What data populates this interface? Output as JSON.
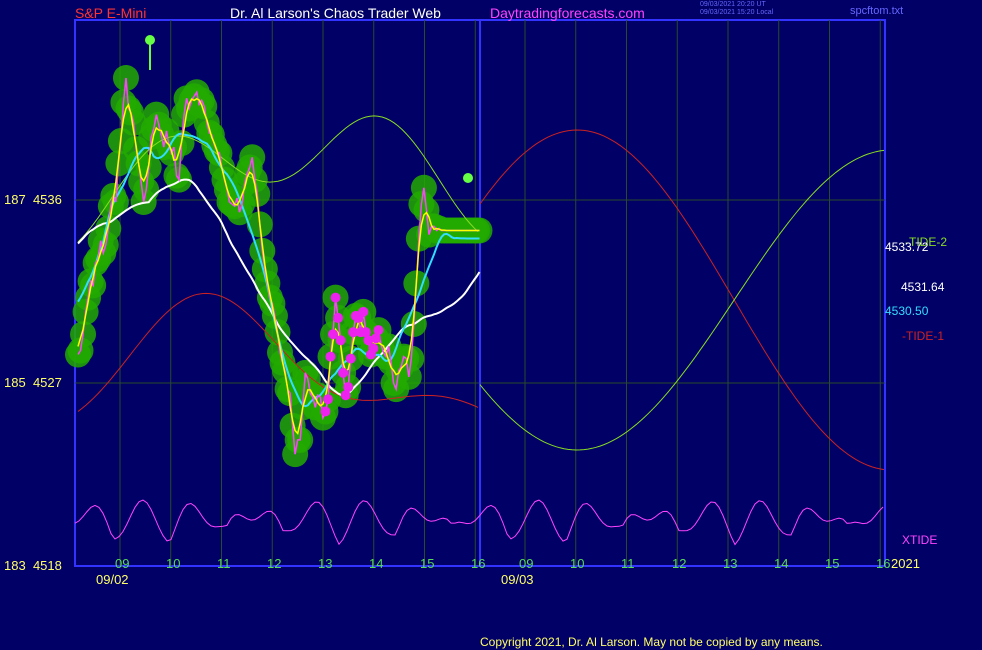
{
  "header": {
    "instrument": "S&P E-Mini",
    "site_title": "Dr. Al Larson's Chaos Trader Web",
    "url": "Daytradingforecasts.com",
    "timestamp_utc": "09/03/2021 20:20 UT",
    "timestamp_local": "09/03/2021 15:20 Local",
    "file": "spcftom.txt"
  },
  "footer": {
    "copyright": "Copyright 2021, Dr. Al Larson. May not be copied by any means."
  },
  "colors": {
    "background": "#000066",
    "frame": "#3333ff",
    "grid": "#2a4a2a",
    "price": "#ff44ff",
    "fast_ma": "#ffff00",
    "mid_ma": "#33ddff",
    "slow_ma": "#ffffff",
    "tide1": "#cc2222",
    "tide2": "#88dd22",
    "xtide": "#ff44ff",
    "green_band": "#22aa00",
    "magenta_dot": "#ee22ee"
  },
  "chart_data": {
    "type": "line",
    "title": "S&P E-Mini",
    "y_left_ticks": [
      {
        "label": "187",
        "price": "4536"
      },
      {
        "label": "185",
        "price": "4527"
      },
      {
        "label": "183",
        "price": "4518"
      }
    ],
    "ylim": [
      4518,
      4536
    ],
    "x_hour_ticks_day1": [
      "09",
      "10",
      "11",
      "12",
      "13",
      "14",
      "15",
      "16"
    ],
    "x_hour_ticks_day2": [
      "09",
      "10",
      "11",
      "12",
      "13",
      "14",
      "15",
      "16"
    ],
    "x_dates": [
      "09/02",
      "09/03"
    ],
    "year_label": "2021",
    "right_labels": [
      {
        "text": "-TIDE-2",
        "color": "#88dd22"
      },
      {
        "text": "4533.72",
        "color": "#ffffff"
      },
      {
        "text": "4531.64",
        "color": "#ffffff"
      },
      {
        "text": "4530.50",
        "color": "#33ddff"
      },
      {
        "text": "-TIDE-1",
        "color": "#cc2222"
      },
      {
        "text": "XTIDE",
        "color": "#ff44ff"
      }
    ],
    "series": [
      {
        "name": "price",
        "color": "#ff44ff",
        "x": [
          0,
          0.05,
          0.1,
          0.15,
          0.2,
          0.25,
          0.3,
          0.35,
          0.4,
          0.45,
          0.5,
          0.55,
          0.6,
          0.65,
          0.7,
          0.75,
          0.8,
          0.85,
          0.9,
          0.95,
          1.0,
          1.05,
          1.1,
          1.15,
          1.2,
          1.25,
          1.3,
          1.35,
          1.4,
          1.45,
          1.5,
          1.55,
          1.6,
          1.65,
          1.7,
          1.75,
          1.8,
          1.85,
          1.9,
          1.95,
          2.0,
          2.05,
          2.1,
          2.15,
          2.2,
          2.25,
          2.3,
          2.35,
          2.4,
          2.45,
          2.5,
          2.55,
          2.6,
          2.65,
          2.7,
          2.75,
          2.8,
          2.85,
          2.9,
          2.95,
          3.0,
          3.05,
          3.1,
          3.15,
          3.2,
          3.25,
          3.3,
          3.35,
          3.4,
          3.45,
          3.5,
          3.55,
          3.6,
          3.65,
          3.7,
          3.75,
          3.8,
          3.85,
          3.9,
          3.95,
          4.0,
          4.05,
          4.1,
          4.15,
          4.2,
          4.25,
          4.3,
          4.35,
          4.4,
          4.45,
          4.5,
          4.55,
          4.6,
          4.65,
          4.7,
          4.75,
          4.8,
          4.85,
          4.9,
          4.95,
          5.0,
          5.05,
          5.1,
          5.15,
          5.2,
          5.25,
          5.3,
          5.35,
          5.4,
          5.45,
          5.5,
          5.55,
          5.6,
          5.65,
          5.7,
          5.75,
          5.8,
          5.85,
          5.9,
          5.95,
          6.0,
          6.05,
          6.1,
          6.15,
          6.2,
          6.25,
          6.3,
          6.35,
          6.4,
          6.45,
          6.5,
          6.55,
          6.6,
          6.65,
          6.7,
          6.75,
          6.8,
          6.85,
          6.9,
          6.95,
          7.0,
          7.05,
          7.1,
          7.15,
          7.2,
          7.25,
          7.3,
          7.35,
          7.4,
          7.45,
          7.5,
          7.55,
          7.6,
          7.65,
          7.7,
          7.75,
          7.8,
          7.85,
          7.9,
          7.95,
          8.0
        ],
        "values": [
          4528.4,
          4528.6,
          4529.4,
          4530.5,
          4531.2,
          4532.0,
          4531.8,
          4532.9,
          4533.1,
          4534.0,
          4533.4,
          4533.8,
          4534.6,
          4535.7,
          4536.2,
          4535.9,
          4537.8,
          4538.9,
          4540.8,
          4542.0,
          4540.5,
          4540.3,
          4539.8,
          4538.5,
          4537.8,
          4536.9,
          4535.9,
          4536.5,
          4537.6,
          4539.1,
          4539.5,
          4540.2,
          4539.7,
          4539.2,
          4538.6,
          4539.4,
          4538.7,
          4538.3,
          4538.6,
          4537.2,
          4537.0,
          4538.8,
          4540.2,
          4541.0,
          4540.5,
          4540.9,
          4541.1,
          4541.3,
          4540.7,
          4540.9,
          4540.6,
          4539.8,
          4539.3,
          4539.2,
          4538.7,
          4538.4,
          4538.3,
          4537.6,
          4537.0,
          4536.5,
          4535.9,
          4535.8,
          4535.7,
          4536.1,
          4535.4,
          4535.8,
          4536.8,
          4537.3,
          4537.6,
          4538.1,
          4537.0,
          4536.3,
          4534.8,
          4533.5,
          4532.6,
          4531.9,
          4531.2,
          4530.9,
          4530.3,
          4529.5,
          4528.5,
          4528.0,
          4527.6,
          4526.7,
          4526.5,
          4524.9,
          4523.5,
          4524.2,
          4524.2,
          4525.8,
          4527.5,
          4527.2,
          4526.5,
          4526.3,
          4525.8,
          4526.4,
          4526.3,
          4525.3,
          4525.6,
          4526.2,
          4528.3,
          4529.4,
          4531.2,
          4530.2,
          4529.1,
          4527.5,
          4526.4,
          4526.8,
          4528.2,
          4529.5,
          4530.3,
          4530.2,
          4529.5,
          4530.5,
          4529.5,
          4529.1,
          4528.4,
          4528.7,
          4529.2,
          4529.6,
          4528.9,
          4528.5,
          4528.3,
          4528.8,
          4528.0,
          4527.0,
          4526.7,
          4527.6,
          4527.8,
          4528.3,
          4528.2,
          4527.3,
          4528.2,
          4529.9,
          4531.9,
          4534.1,
          4535.8,
          4536.6,
          4535.5,
          4534.3,
          4534.7,
          4534.7,
          4534.5,
          4534.6,
          4534.5,
          4534.5,
          4534.5,
          4534.5,
          4534.5,
          4534.5,
          4534.5,
          4534.5,
          4534.5,
          4534.5,
          4534.5,
          4534.5,
          4534.5,
          4534.5,
          4534.5,
          4534.5,
          4534.5
        ]
      }
    ]
  }
}
